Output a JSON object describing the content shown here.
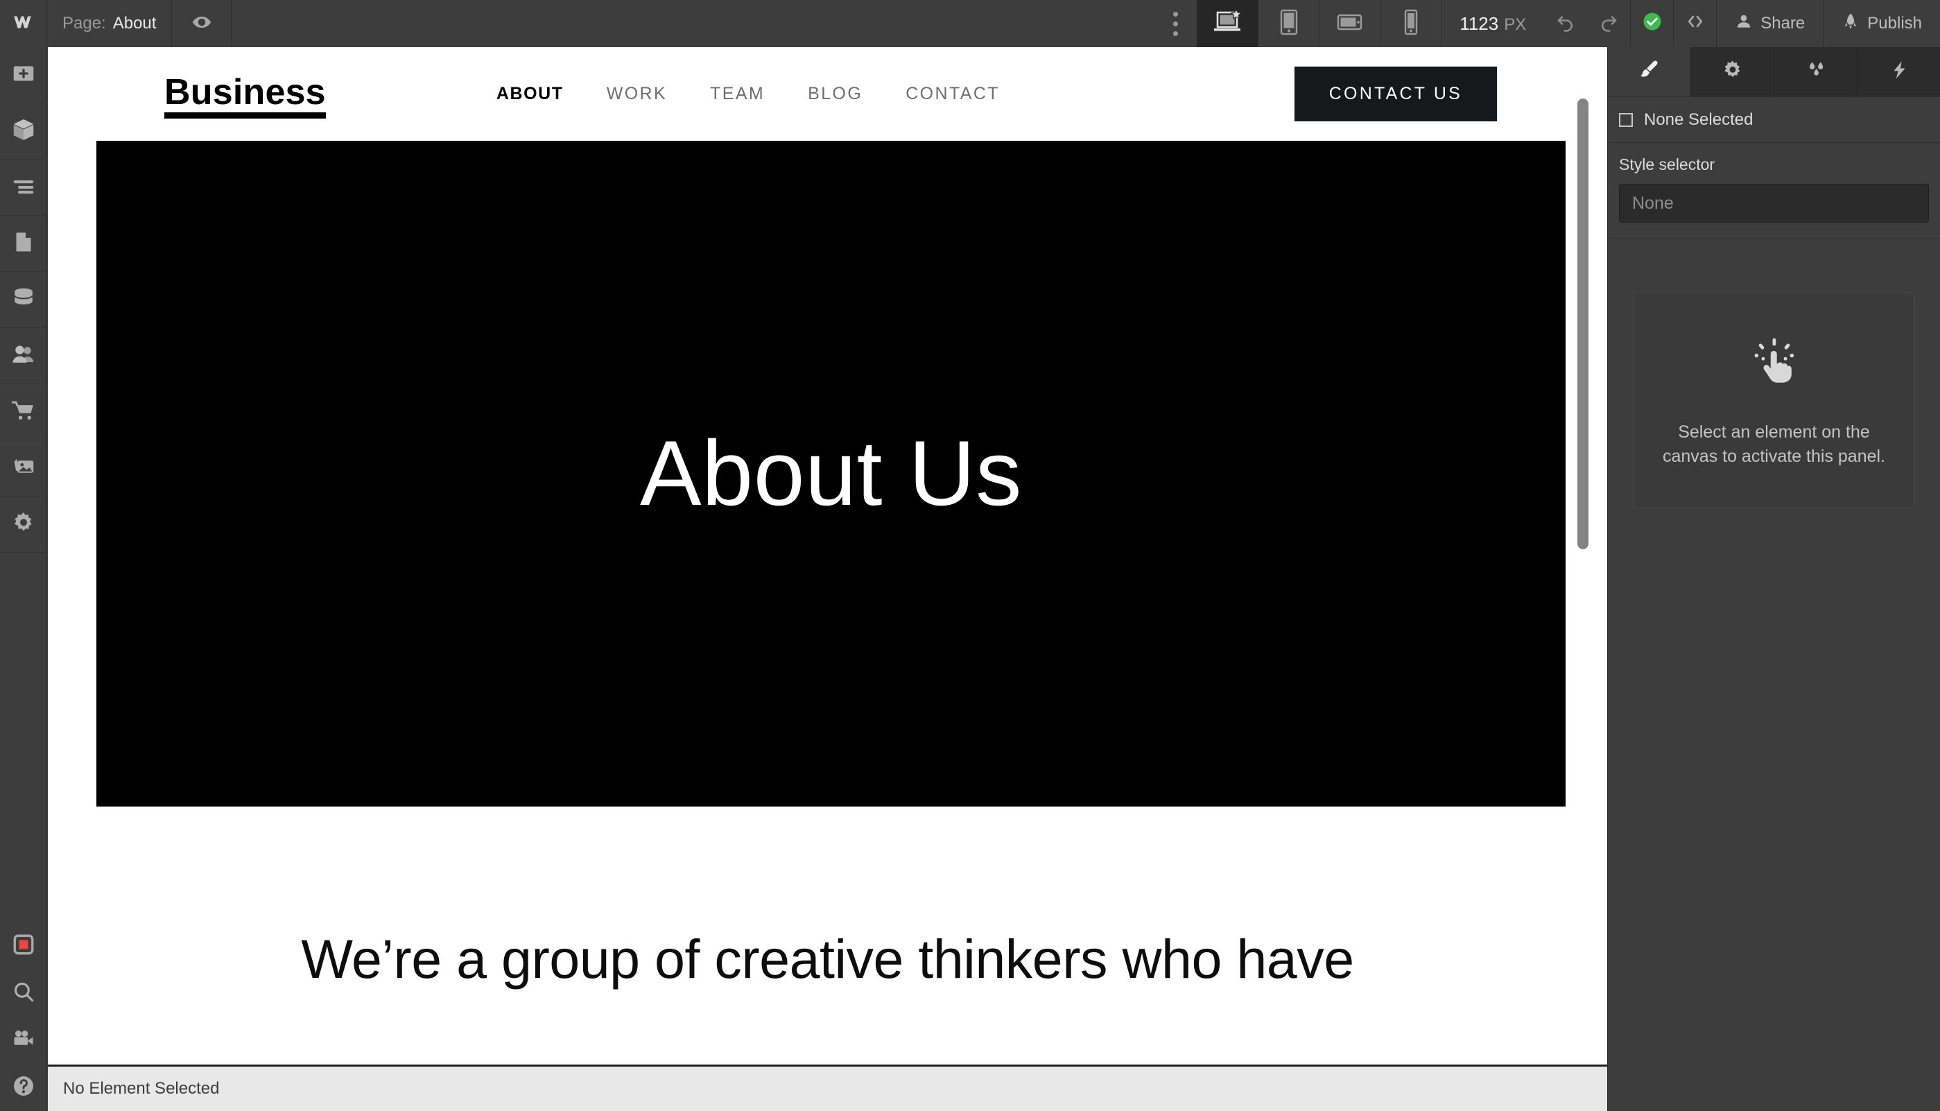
{
  "topbar": {
    "logo_icon": "webflow-logo-icon",
    "page_label": "Page:",
    "page_name": "About",
    "preview_icon": "eye-icon",
    "overflow_icon": "vertical-dots-icon",
    "breakpoints": [
      {
        "name": "desktop-breakpoint",
        "icon": "desktop-star-icon",
        "active": true
      },
      {
        "name": "tablet-breakpoint",
        "icon": "tablet-portrait-icon",
        "active": false
      },
      {
        "name": "mobile-landscape-breakpoint",
        "icon": "mobile-landscape-icon",
        "active": false
      },
      {
        "name": "mobile-portrait-breakpoint",
        "icon": "mobile-portrait-icon",
        "active": false
      }
    ],
    "zoom_value": "1123",
    "zoom_unit": "PX",
    "undo_icon": "undo-arrow-icon",
    "redo_icon": "redo-arrow-icon",
    "saved_icon": "checkmark-circle-icon",
    "saved_color": "#3dbb4e",
    "code_icon": "code-brackets-icon",
    "share_label": "Share",
    "share_icon": "person-icon",
    "publish_label": "Publish",
    "publish_icon": "rocket-icon"
  },
  "leftbar": {
    "items": [
      {
        "name": "add-elements",
        "icon": "plus-box-icon"
      },
      {
        "name": "components",
        "icon": "cube-icon"
      },
      {
        "name": "navigator",
        "icon": "navigator-lines-icon"
      },
      {
        "name": "pages",
        "icon": "page-document-icon"
      },
      {
        "name": "cms-collections",
        "icon": "database-icon"
      },
      {
        "name": "users",
        "icon": "people-icon"
      },
      {
        "name": "ecommerce",
        "icon": "shopping-cart-icon"
      },
      {
        "name": "assets",
        "icon": "images-icon"
      },
      {
        "name": "settings",
        "icon": "gear-icon"
      }
    ],
    "bottom_items": [
      {
        "name": "audit-panel",
        "icon": "red-square-icon",
        "color": "#f2453d"
      },
      {
        "name": "search-panel",
        "icon": "search-icon"
      },
      {
        "name": "video-tutorials",
        "icon": "video-camera-icon"
      },
      {
        "name": "help",
        "icon": "question-circle-icon"
      }
    ]
  },
  "canvas": {
    "site_nav": {
      "logo_text": "Business",
      "links": [
        {
          "label": "ABOUT",
          "current": true
        },
        {
          "label": "WORK",
          "current": false
        },
        {
          "label": "TEAM",
          "current": false
        },
        {
          "label": "BLOG",
          "current": false
        },
        {
          "label": "CONTACT",
          "current": false
        }
      ],
      "cta_label": "CONTACT US",
      "cta_bg": "#16191c"
    },
    "hero": {
      "heading": "About Us",
      "background": "#000000",
      "text_color": "#ffffff"
    },
    "section_heading": "We’re a group of creative thinkers who have"
  },
  "rightpanel": {
    "tabs": [
      {
        "name": "style-tab",
        "icon": "paintbrush-icon",
        "active": true
      },
      {
        "name": "settings-tab",
        "icon": "gear-icon",
        "active": false
      },
      {
        "name": "interactions-tab",
        "icon": "water-drops-icon",
        "active": false
      },
      {
        "name": "effects-tab",
        "icon": "lightning-bolt-icon",
        "active": false
      }
    ],
    "selection_status": "None Selected",
    "style_selector_label": "Style selector",
    "style_selector_placeholder": "None",
    "empty_icon": "click-hand-icon",
    "empty_message": "Select an element on the canvas to activate this panel."
  },
  "statusbar": {
    "message": "No Element Selected"
  }
}
